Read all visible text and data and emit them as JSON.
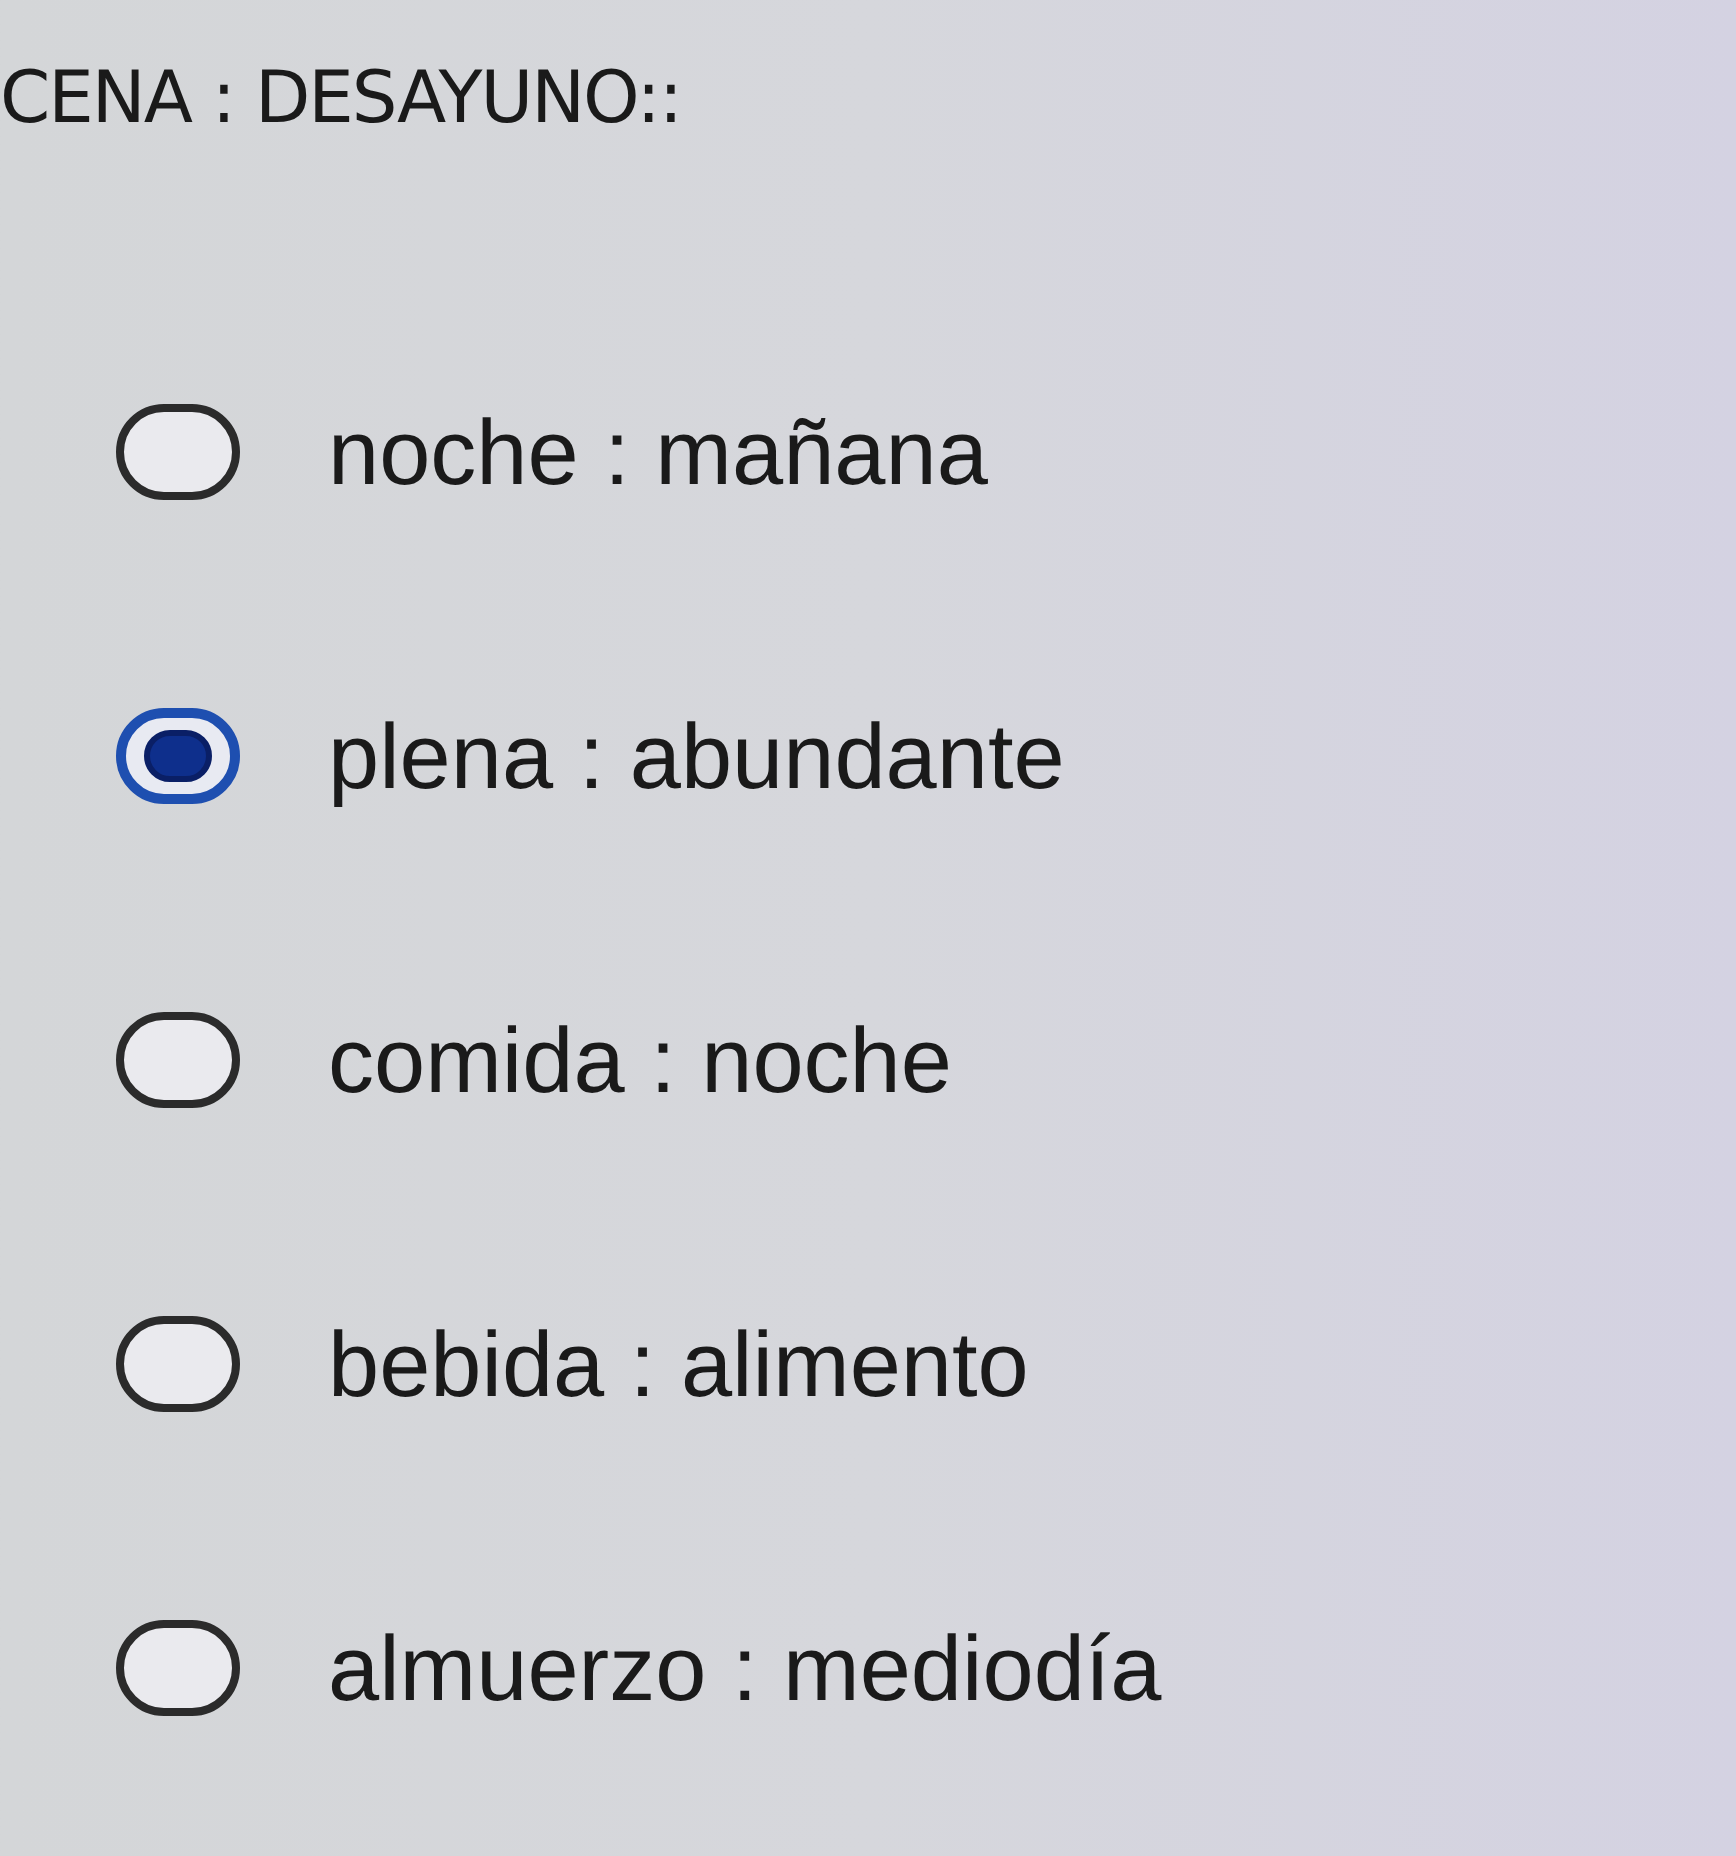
{
  "question": "CENA : DESAYUNO::",
  "options": [
    {
      "label": "noche : mañana",
      "selected": false
    },
    {
      "label": "plena : abundante",
      "selected": true
    },
    {
      "label": "comida : noche",
      "selected": false
    },
    {
      "label": "bebida : alimento",
      "selected": false
    },
    {
      "label": "almuerzo : mediodía",
      "selected": false
    }
  ]
}
